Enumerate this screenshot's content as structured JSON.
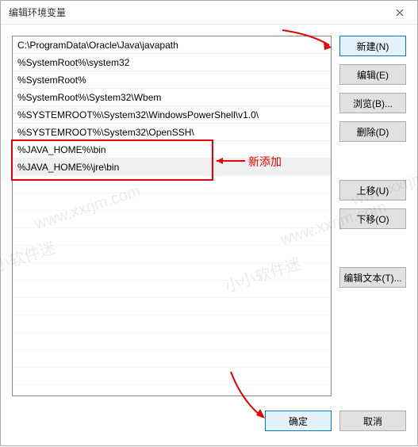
{
  "window": {
    "title": "编辑环境变量"
  },
  "list": {
    "items": [
      "C:\\ProgramData\\Oracle\\Java\\javapath",
      "%SystemRoot%\\system32",
      "%SystemRoot%",
      "%SystemRoot%\\System32\\Wbem",
      "%SYSTEMROOT%\\System32\\WindowsPowerShell\\v1.0\\",
      "%SYSTEMROOT%\\System32\\OpenSSH\\",
      "%JAVA_HOME%\\bin",
      "%JAVA_HOME%\\jre\\bin"
    ]
  },
  "buttons": {
    "new": "新建(N)",
    "edit": "编辑(E)",
    "browse": "浏览(B)...",
    "delete": "删除(D)",
    "moveup": "上移(U)",
    "movedown": "下移(O)",
    "edittext": "编辑文本(T)...",
    "ok": "确定",
    "cancel": "取消"
  },
  "annotation": {
    "label": "新添加"
  },
  "watermark": {
    "text1": "小小软件迷",
    "text2": "www.xxrjm.com"
  }
}
